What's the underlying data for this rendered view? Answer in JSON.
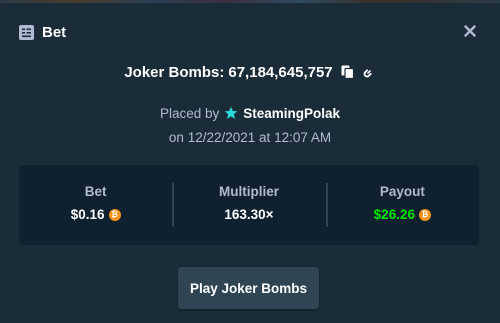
{
  "modal": {
    "title": "Bet",
    "title_icon": "bet-slip-icon",
    "close_icon": "close-icon"
  },
  "bet": {
    "game": "Joker Bombs",
    "bet_id": "67,184,645,757",
    "copy_icon": "copy-icon",
    "link_icon": "link-icon",
    "placed_by_label": "Placed by",
    "user_icon": "star-rank-icon",
    "username": "SteamingPolak",
    "date_prefix": "on",
    "date": "12/22/2021",
    "at_word": "at",
    "time": "12:07 AM"
  },
  "stats": {
    "bet_label": "Bet",
    "bet_value": "$0.16",
    "multiplier_label": "Multiplier",
    "multiplier_value": "163.30×",
    "payout_label": "Payout",
    "payout_value": "$26.26",
    "currency_icon": "bitcoin-icon",
    "currency_symbol": "₿"
  },
  "actions": {
    "play_label": "Play Joker Bombs"
  },
  "colors": {
    "background": "#1a2c38",
    "panel": "#0f212e",
    "muted_text": "#b1bad3",
    "payout_green": "#00e701",
    "button": "#2f4553",
    "coin": "#f7931a",
    "rank_star": "#2bd9d9"
  }
}
